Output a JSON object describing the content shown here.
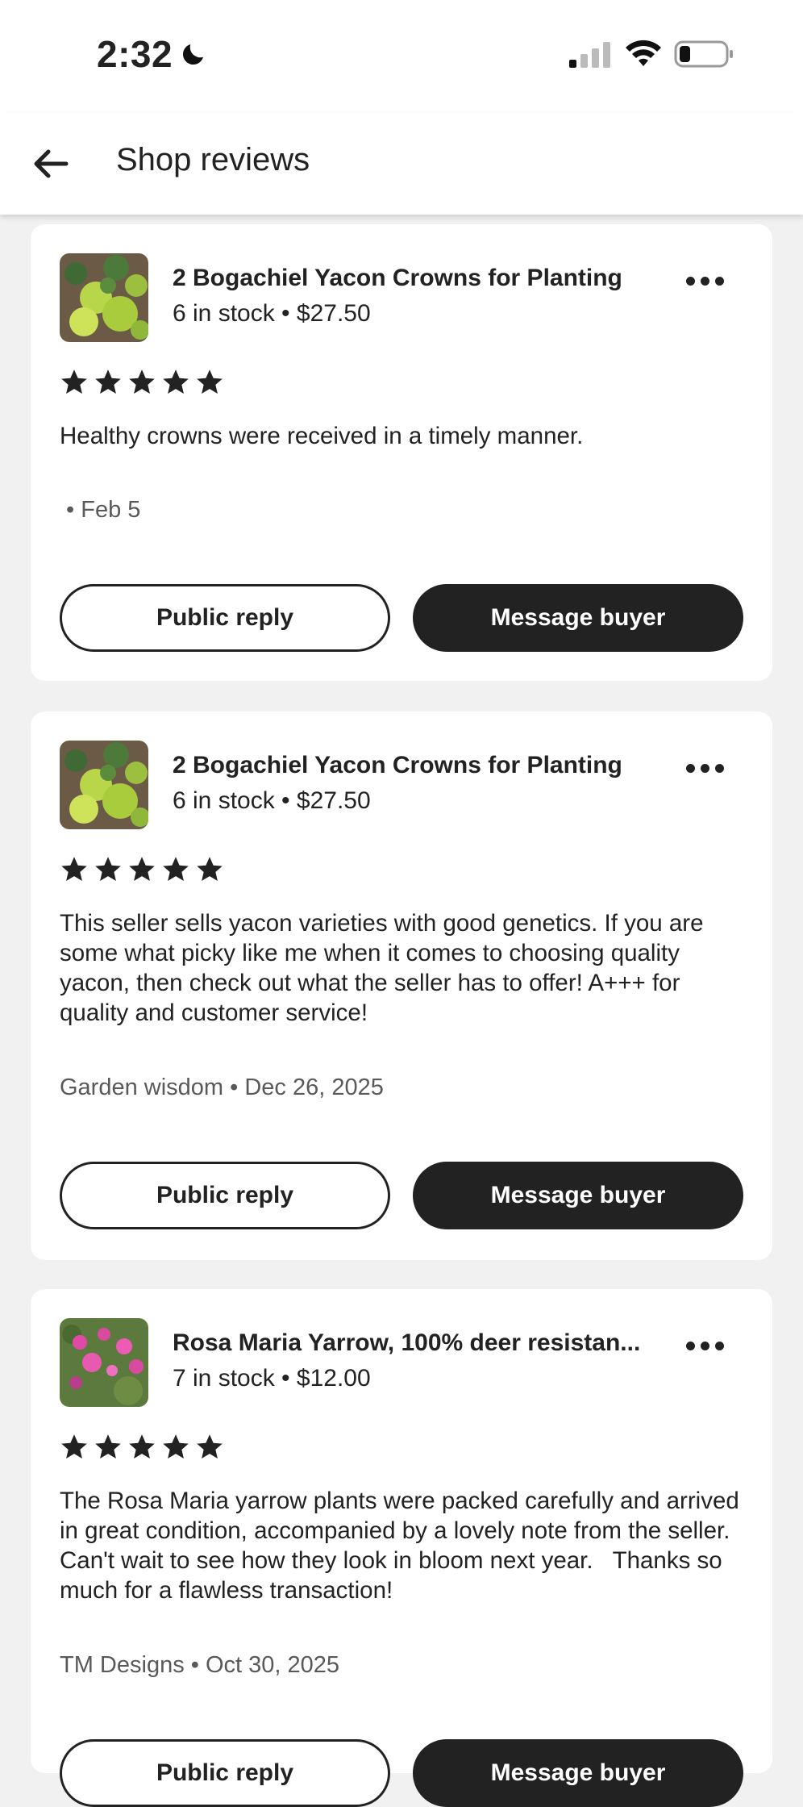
{
  "status_bar": {
    "time": "2:32"
  },
  "header": {
    "title": "Shop reviews"
  },
  "reviews": [
    {
      "item_title": "2 Bogachiel Yacon Crowns for Planting",
      "item_meta": "6 in stock • $27.50",
      "rating": 5,
      "text": "Healthy crowns were received in a timely manner.",
      "byline": " • Feb 5",
      "public_reply_label": "Public reply",
      "message_buyer_label": "Message buyer"
    },
    {
      "item_title": "2 Bogachiel Yacon Crowns for Planting",
      "item_meta": "6 in stock • $27.50",
      "rating": 5,
      "text": "This seller sells yacon varieties with good genetics. If you are some what picky like me when it comes to choosing quality yacon, then check out what the seller has to offer! A+++ for quality and customer service!",
      "byline": "Garden wisdom • Dec 26, 2025",
      "public_reply_label": "Public reply",
      "message_buyer_label": "Message buyer"
    },
    {
      "item_title": "Rosa Maria Yarrow, 100% deer resistan...",
      "item_meta": "7 in stock • $12.00",
      "rating": 5,
      "text": "The Rosa Maria yarrow plants were packed carefully and arrived in great condition, accompanied by a lovely note from the seller.  Can't wait to see how they look in bloom next year.   Thanks so much for a flawless transaction!",
      "byline": "TM Designs • Oct 30, 2025",
      "public_reply_label": "Public reply",
      "message_buyer_label": "Message buyer"
    }
  ],
  "icons": {
    "back": "arrow-left-icon",
    "more": "more-horizontal-icon",
    "star": "star-icon"
  },
  "colors": {
    "primary_button": "#222222",
    "background": "#f1f1f1",
    "card": "#ffffff"
  }
}
